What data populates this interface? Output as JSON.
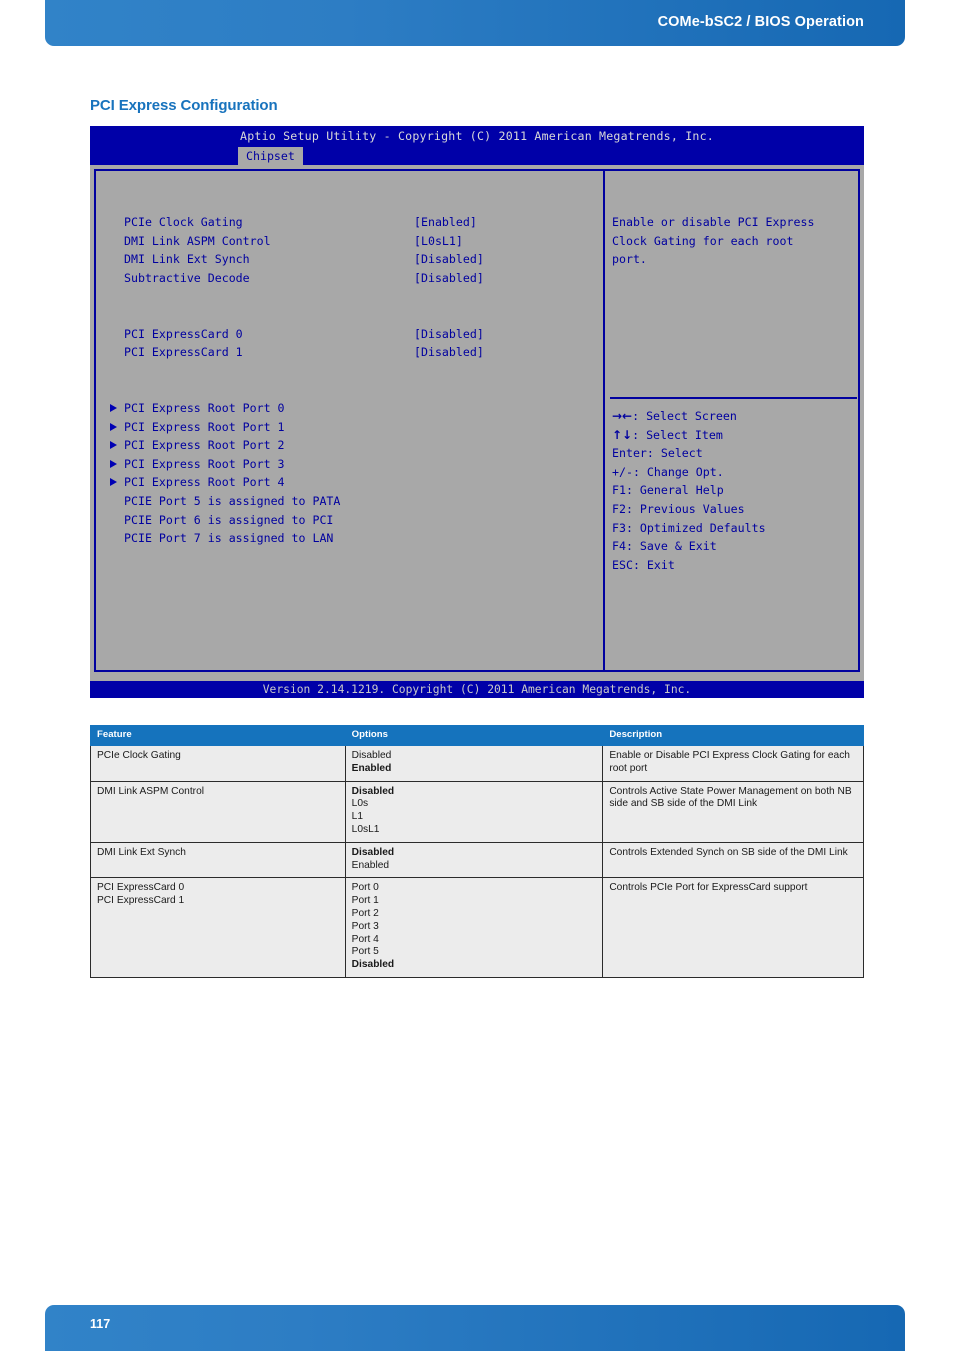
{
  "header": {
    "title": "COMe-bSC2 / BIOS Operation"
  },
  "section": {
    "heading": "PCI Express Configuration"
  },
  "bios": {
    "title": "Aptio Setup Utility - Copyright (C) 2011 American Megatrends, Inc.",
    "tab": "Chipset",
    "settings": [
      {
        "label": "PCIe Clock Gating",
        "value": "[Enabled]",
        "arrow": false,
        "highlight": false
      },
      {
        "label": "DMI Link ASPM Control",
        "value": "[L0sL1]",
        "arrow": false,
        "highlight": true
      },
      {
        "label": "DMI Link Ext Synch",
        "value": "[Disabled]",
        "arrow": false,
        "highlight": true
      },
      {
        "label": "Subtractive Decode",
        "value": "[Disabled]",
        "arrow": false,
        "highlight": false
      }
    ],
    "expresscards": [
      {
        "label": "PCI ExpressCard 0",
        "value": "[Disabled]"
      },
      {
        "label": "PCI ExpressCard 1",
        "value": "[Disabled]"
      }
    ],
    "rootports": [
      "PCI Express Root Port 0",
      "PCI Express Root Port 1",
      "PCI Express Root Port 2",
      "PCI Express Root Port 3",
      "PCI Express Root Port 4"
    ],
    "assignments": [
      "PCIE Port 5 is assigned to PATA",
      "PCIE Port 6 is assigned to PCI",
      "PCIE Port 7 is assigned to LAN"
    ],
    "help": [
      "Enable or disable PCI Express",
      "Clock Gating for each root",
      "port."
    ],
    "keys": [
      {
        "glyph": "→←",
        "text": ": Select Screen"
      },
      {
        "glyph": "↑↓",
        "text": ": Select Item"
      },
      {
        "glyph": "",
        "text": "Enter: Select"
      },
      {
        "glyph": "",
        "text": "+/-: Change Opt."
      },
      {
        "glyph": "",
        "text": "F1: General Help"
      },
      {
        "glyph": "",
        "text": "F2: Previous Values"
      },
      {
        "glyph": "",
        "text": "F3: Optimized Defaults"
      },
      {
        "glyph": "",
        "text": "F4: Save & Exit"
      },
      {
        "glyph": "",
        "text": "ESC: Exit"
      }
    ],
    "version": "Version 2.14.1219. Copyright (C) 2011 American Megatrends, Inc."
  },
  "table": {
    "columns": [
      "Feature",
      "Options",
      "Description"
    ],
    "rows": [
      {
        "feature": [
          "PCIe Clock Gating"
        ],
        "options": [
          {
            "text": "Disabled",
            "bold": false
          },
          {
            "text": "Enabled",
            "bold": true
          }
        ],
        "description": "Enable or Disable PCI Express Clock Gating for each root port"
      },
      {
        "feature": [
          "DMI Link ASPM Control"
        ],
        "options": [
          {
            "text": "Disabled",
            "bold": true
          },
          {
            "text": "L0s",
            "bold": false
          },
          {
            "text": "L1",
            "bold": false
          },
          {
            "text": "L0sL1",
            "bold": false
          }
        ],
        "description": "Controls Active State Power Management on both NB side and SB side of the DMI Link"
      },
      {
        "feature": [
          "DMI Link Ext Synch"
        ],
        "options": [
          {
            "text": "Disabled",
            "bold": true
          },
          {
            "text": "Enabled",
            "bold": false
          }
        ],
        "description": "Controls Extended Synch on SB side of the DMI Link"
      },
      {
        "feature": [
          "PCI ExpressCard 0",
          "PCI ExpressCard 1"
        ],
        "options": [
          {
            "text": "Port 0",
            "bold": false
          },
          {
            "text": "Port 1",
            "bold": false
          },
          {
            "text": "Port 2",
            "bold": false
          },
          {
            "text": "Port 3",
            "bold": false
          },
          {
            "text": "Port 4",
            "bold": false
          },
          {
            "text": "Port 5",
            "bold": false
          },
          {
            "text": "Disabled",
            "bold": true
          }
        ],
        "description": "Controls PCIe Port for ExpressCard support"
      }
    ]
  },
  "footer": {
    "page_number": "117"
  },
  "colors": {
    "brand_blue": "#1573bd",
    "bios_blue": "#0000a8",
    "bios_gray": "#a8a8a8",
    "table_row": "#ececec"
  }
}
